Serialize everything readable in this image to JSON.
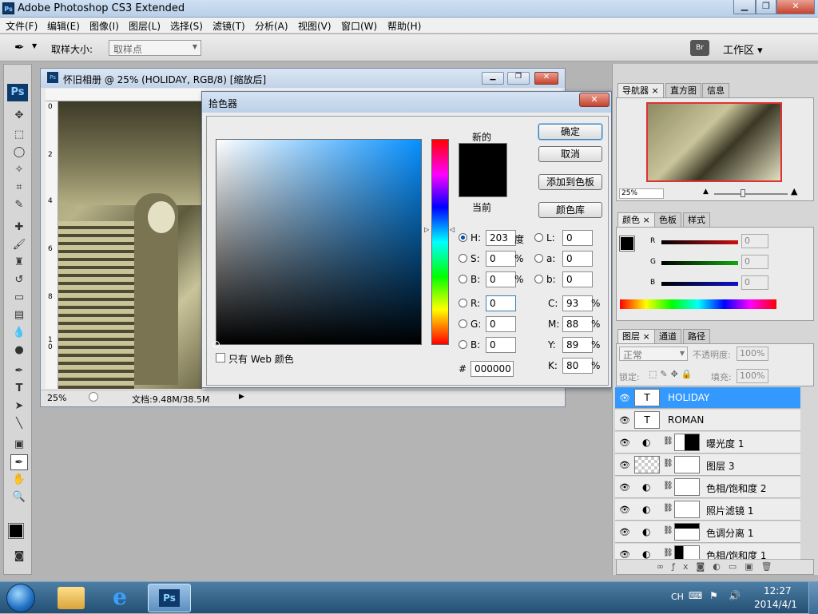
{
  "app": {
    "title": "Adobe Photoshop CS3 Extended",
    "icon": "Ps"
  },
  "menu": [
    "文件(F)",
    "编辑(E)",
    "图像(I)",
    "图层(L)",
    "选择(S)",
    "滤镜(T)",
    "分析(A)",
    "视图(V)",
    "窗口(W)",
    "帮助(H)"
  ],
  "options": {
    "sample_size_label": "取样大小:",
    "sample_size_value": "取样点",
    "workspace": "工作区 ▾"
  },
  "document": {
    "title": "怀旧相册 @ 25% (HOLIDAY, RGB/8) [缩放后]",
    "zoom": "25%",
    "doc_size": "文档:9.48M/38.5M",
    "ruler": [
      "0",
      "2",
      "4",
      "6",
      "8",
      "1\n0"
    ]
  },
  "picker": {
    "title": "拾色器",
    "new_label": "新的",
    "current_label": "当前",
    "ok": "确定",
    "cancel": "取消",
    "add_swatch": "添加到色板",
    "libraries": "颜色库",
    "web_only": "只有 Web 颜色",
    "hsb": [
      {
        "k": "H:",
        "v": "203",
        "u": "度"
      },
      {
        "k": "S:",
        "v": "0",
        "u": "%"
      },
      {
        "k": "B:",
        "v": "0",
        "u": "%"
      }
    ],
    "lab": [
      {
        "k": "L:",
        "v": "0"
      },
      {
        "k": "a:",
        "v": "0"
      },
      {
        "k": "b:",
        "v": "0"
      }
    ],
    "rgb": [
      {
        "k": "R:",
        "v": "0"
      },
      {
        "k": "G:",
        "v": "0"
      },
      {
        "k": "B:",
        "v": "0"
      }
    ],
    "cmyk": [
      {
        "k": "C:",
        "v": "93",
        "u": "%"
      },
      {
        "k": "M:",
        "v": "88",
        "u": "%"
      },
      {
        "k": "Y:",
        "v": "89",
        "u": "%"
      },
      {
        "k": "K:",
        "v": "80",
        "u": "%"
      }
    ],
    "hex_label": "#",
    "hex": "000000",
    "new_color": "#000000",
    "current_color": "#000000"
  },
  "navigator": {
    "tabs": [
      "导航器",
      "直方图",
      "信息"
    ],
    "zoom": "25%"
  },
  "color_panel": {
    "tabs": [
      "颜色",
      "色板",
      "样式"
    ],
    "sliders": [
      {
        "k": "R",
        "v": "0",
        "color": "#cc1111"
      },
      {
        "k": "G",
        "v": "0",
        "color": "#11aa11"
      },
      {
        "k": "B",
        "v": "0",
        "color": "#1111cc"
      }
    ]
  },
  "layers": {
    "tabs": [
      "图层",
      "通道",
      "路径"
    ],
    "mode": "正常",
    "opacity_label": "不透明度:",
    "opacity": "100%",
    "lock_label": "锁定:",
    "fill_label": "填充:",
    "fill": "100%",
    "items": [
      {
        "name": "HOLIDAY",
        "thumb": "T",
        "selected": true
      },
      {
        "name": "ROMAN",
        "thumb": "T",
        "selected": false
      },
      {
        "name": "曝光度 1",
        "thumb": "",
        "selected": false
      },
      {
        "name": "图层 3",
        "thumb": "",
        "selected": false
      },
      {
        "name": "色相/饱和度 2",
        "thumb": "",
        "selected": false
      },
      {
        "name": "照片滤镜 1",
        "thumb": "",
        "selected": false
      },
      {
        "name": "色调分离 1",
        "thumb": "",
        "selected": false
      },
      {
        "name": "色相/饱和度 1",
        "thumb": "",
        "selected": false
      }
    ]
  },
  "taskbar": {
    "lang": "CH",
    "time": "12:27",
    "date": "2014/4/1",
    "ps": "Ps"
  }
}
